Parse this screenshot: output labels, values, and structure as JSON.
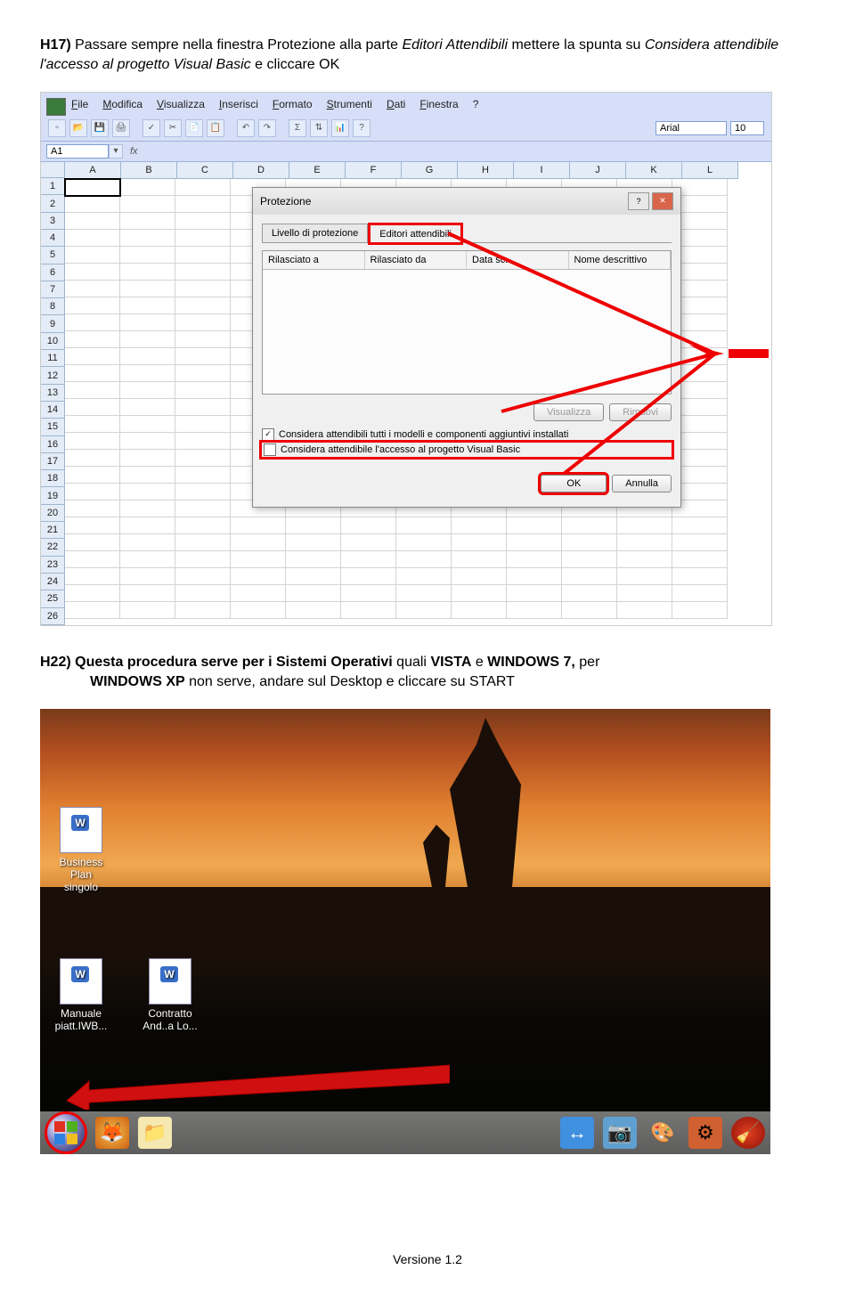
{
  "paragraph1": {
    "step": "H17)",
    "text1": " Passare sempre nella finestra Protezione alla parte ",
    "italic1": "Editori Attendibili",
    "text2": "  mettere la spunta su ",
    "italic2": "Considera attendibile l'accesso al progetto Visual Basic",
    "text3": " e cliccare OK"
  },
  "excel": {
    "menu": [
      "File",
      "Modifica",
      "Visualizza",
      "Inserisci",
      "Formato",
      "Strumenti",
      "Dati",
      "Finestra",
      "?"
    ],
    "font_name": "Arial",
    "font_size": "10",
    "namebox": "A1",
    "cols": [
      "A",
      "B",
      "C",
      "D",
      "E",
      "F",
      "G",
      "H",
      "I",
      "J",
      "K",
      "L"
    ],
    "rows": [
      "1",
      "2",
      "3",
      "4",
      "5",
      "6",
      "7",
      "8",
      "9",
      "10",
      "11",
      "12",
      "13",
      "14",
      "15",
      "16",
      "17",
      "18",
      "19",
      "20",
      "21",
      "22",
      "23",
      "24",
      "25",
      "26"
    ]
  },
  "dialog": {
    "title": "Protezione",
    "tab1": "Livello di protezione",
    "tab2": "Editori attendibili",
    "col1": "Rilasciato a",
    "col2": "Rilasciato da",
    "col3": "Data sc...",
    "col4": "Nome descrittivo",
    "btn_view": "Visualizza",
    "btn_remove": "Rimuovi",
    "chk1": "Considera attendibili tutti i modelli e componenti aggiuntivi installati",
    "chk2": "Considera attendibile l'accesso al progetto Visual Basic",
    "btn_ok": "OK",
    "btn_cancel": "Annulla"
  },
  "paragraph2": {
    "step": "H22)",
    "text1": " Questa procedura serve per i Sistemi Operativi",
    "text2": " quali ",
    "bold1": "VISTA",
    "text3": " e ",
    "bold2": "WINDOWS 7, ",
    "text4": "per ",
    "bold3": "WINDOWS XP",
    "text5": " non serve, andare sul Desktop e cliccare su START"
  },
  "desktop": {
    "icon1_l1": "Business Plan",
    "icon1_l2": "singolo",
    "icon2_l1": "Manuale",
    "icon2_l2": "piatt.IWB...",
    "icon3_l1": "Contratto",
    "icon3_l2": "And..a Lo..."
  },
  "footer": "Versione 1.2"
}
